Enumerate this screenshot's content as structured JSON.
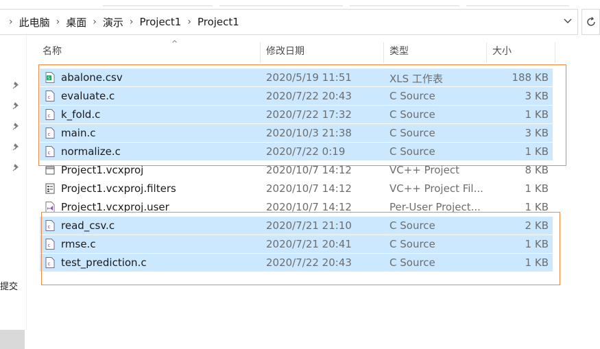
{
  "breadcrumb": [
    "此电脑",
    "桌面",
    "演示",
    "Project1",
    "Project1"
  ],
  "nav": {
    "partial_label": "提交"
  },
  "columns": {
    "name": "名称",
    "date": "修改日期",
    "type": "类型",
    "size": "大小"
  },
  "files": [
    {
      "name": "abalone.csv",
      "date": "2020/5/19 11:51",
      "type": "XLS 工作表",
      "size": "188 KB",
      "icon": "excel-csv-icon",
      "selected": true
    },
    {
      "name": "evaluate.c",
      "date": "2020/7/22 20:43",
      "type": "C Source",
      "size": "3 KB",
      "icon": "c-source-file-icon",
      "selected": true
    },
    {
      "name": "k_fold.c",
      "date": "2020/7/22 17:32",
      "type": "C Source",
      "size": "1 KB",
      "icon": "c-source-file-icon",
      "selected": true
    },
    {
      "name": "main.c",
      "date": "2020/10/3 21:38",
      "type": "C Source",
      "size": "3 KB",
      "icon": "c-source-file-icon",
      "selected": true
    },
    {
      "name": "normalize.c",
      "date": "2020/7/22 0:19",
      "type": "C Source",
      "size": "1 KB",
      "icon": "c-source-file-icon",
      "selected": true
    },
    {
      "name": "Project1.vcxproj",
      "date": "2020/10/7 14:12",
      "type": "VC++ Project",
      "size": "8 KB",
      "icon": "vcxproj-file-icon",
      "selected": false
    },
    {
      "name": "Project1.vcxproj.filters",
      "date": "2020/10/7 14:12",
      "type": "VC++ Project Fil...",
      "size": "1 KB",
      "icon": "filters-file-icon",
      "selected": false
    },
    {
      "name": "Project1.vcxproj.user",
      "date": "2020/10/7 14:12",
      "type": "Per-User Project...",
      "size": "1 KB",
      "icon": "visual-studio-user-icon",
      "selected": false
    },
    {
      "name": "read_csv.c",
      "date": "2020/7/21 21:10",
      "type": "C Source",
      "size": "2 KB",
      "icon": "c-source-file-icon",
      "selected": true
    },
    {
      "name": "rmse.c",
      "date": "2020/7/21 20:41",
      "type": "C Source",
      "size": "1 KB",
      "icon": "c-source-file-icon",
      "selected": true
    },
    {
      "name": "test_prediction.c",
      "date": "2020/7/22 20:43",
      "type": "C Source",
      "size": "1 KB",
      "icon": "c-source-file-icon",
      "selected": true
    }
  ],
  "colors": {
    "selection": "#cce8ff",
    "highlight_box": "#f08a3c"
  }
}
